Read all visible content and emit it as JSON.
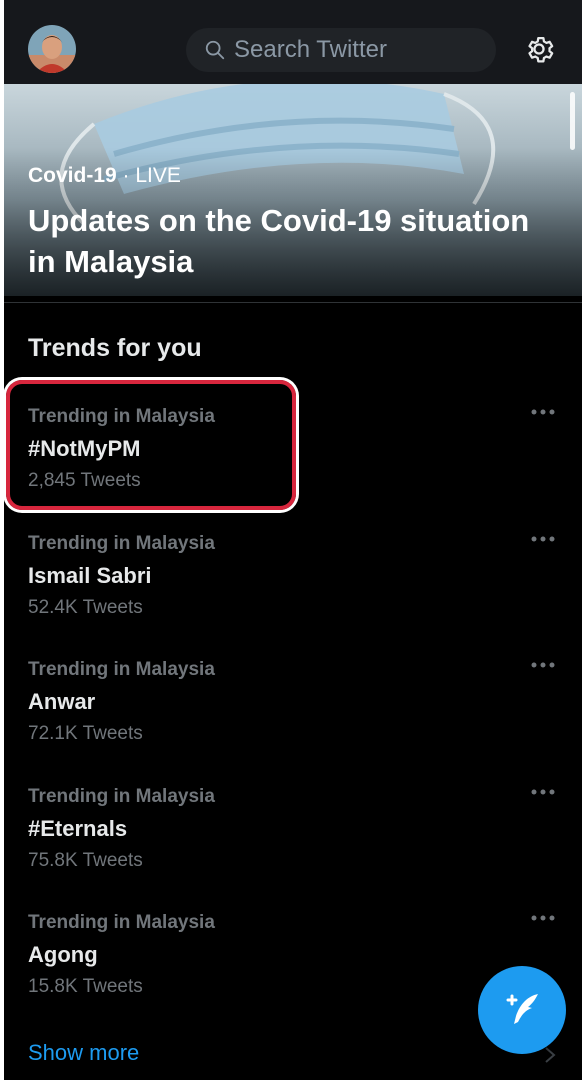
{
  "header": {
    "search_placeholder": "Search Twitter"
  },
  "hero": {
    "topic": "Covid-19",
    "separator": "·",
    "status": "LIVE",
    "title": "Updates on the Covid-19 situation in Malaysia"
  },
  "trends": {
    "section_title": "Trends for you",
    "items": [
      {
        "context": "Trending in Malaysia",
        "name": "#NotMyPM",
        "count": "2,845 Tweets"
      },
      {
        "context": "Trending in Malaysia",
        "name": "Ismail Sabri",
        "count": "52.4K Tweets"
      },
      {
        "context": "Trending in Malaysia",
        "name": "Anwar",
        "count": "72.1K Tweets"
      },
      {
        "context": "Trending in Malaysia",
        "name": "#Eternals",
        "count": "75.8K Tweets"
      },
      {
        "context": "Trending in Malaysia",
        "name": "Agong",
        "count": "15.8K Tweets"
      }
    ],
    "show_more": "Show more"
  },
  "icons": {
    "search": "search-icon",
    "settings": "gear-icon",
    "more": "more-dots-icon",
    "compose": "compose-tweet-icon",
    "chevron": "chevron-right-icon"
  },
  "colors": {
    "accent": "#1d9bf0",
    "background": "#000000",
    "highlight": "#d7263d"
  }
}
